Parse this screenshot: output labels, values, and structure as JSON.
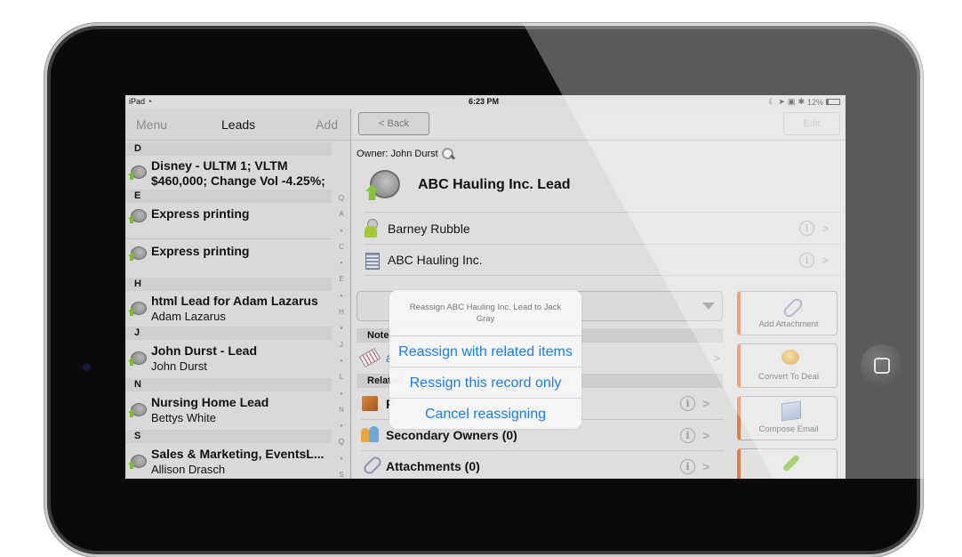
{
  "status_bar": {
    "device": "iPad",
    "wifi_icon": "wifi-icon",
    "time": "6:23 PM",
    "battery_percent": "12%"
  },
  "left_nav": {
    "menu_label": "Menu",
    "title": "Leads",
    "add_label": "Add"
  },
  "leads": {
    "sections": [
      {
        "header": "D",
        "items": [
          {
            "title": "Disney - ULTM 1; VLTM $460,000; Change Vol -4.25%;",
            "title_line1": "Disney - ULTM 1; VLTM",
            "title_line2": "$460,000; Change Vol -4.25%;",
            "subtitle": ""
          }
        ]
      },
      {
        "header": "E",
        "items": [
          {
            "title": "Express printing",
            "subtitle": ""
          },
          {
            "title": "Express printing",
            "subtitle": ""
          }
        ]
      },
      {
        "header": "H",
        "items": [
          {
            "title": "html Lead for Adam Lazarus",
            "subtitle": "Adam Lazarus"
          }
        ]
      },
      {
        "header": "J",
        "items": [
          {
            "title": "John Durst - Lead",
            "subtitle": "John Durst"
          }
        ]
      },
      {
        "header": "N",
        "items": [
          {
            "title": "Nursing Home Lead",
            "subtitle": "Bettys White"
          }
        ]
      },
      {
        "header": "S",
        "items": [
          {
            "title": "Sales & Marketing, EventsL...",
            "subtitle": "Allison Drasch"
          }
        ]
      }
    ]
  },
  "index_bar": [
    "Q",
    "A",
    "•",
    "C",
    "•",
    "E",
    "•",
    "H",
    "•",
    "J",
    "•",
    "L",
    "•",
    "N",
    "•",
    "Q",
    "•",
    "S"
  ],
  "right_nav": {
    "back_label": "< Back",
    "edit_label": "Edit"
  },
  "record": {
    "owner_line": "Owner: John Durst",
    "title": "ABC Hauling Inc. Lead",
    "contact": "Barney Rubble",
    "company": "ABC Hauling Inc.",
    "notes_header": "Notes",
    "note_link": "a",
    "related_header": "Related",
    "related": [
      {
        "label": "F",
        "icon": "box-icon"
      },
      {
        "label": "Secondary Owners (0)",
        "icon": "people-icon"
      },
      {
        "label": "Attachments (0)",
        "icon": "paperclip-icon"
      }
    ]
  },
  "actions": [
    {
      "label": "Add Attachment",
      "icon": "paperclip-icon"
    },
    {
      "label": "Convert To Deal",
      "icon": "coin-icon"
    },
    {
      "label": "Compose Email",
      "icon": "envelope-icon"
    },
    {
      "label": "",
      "icon": "phone-icon"
    }
  ],
  "alert": {
    "message": "Reassign ABC Hauling Inc. Lead to Jack Gray",
    "buttons": [
      "Reassign with related items",
      "Ressign this record only",
      "Cancel reassigning"
    ]
  },
  "colors": {
    "accent_blue": "#1a7ee8",
    "action_orange": "#e07b45"
  }
}
